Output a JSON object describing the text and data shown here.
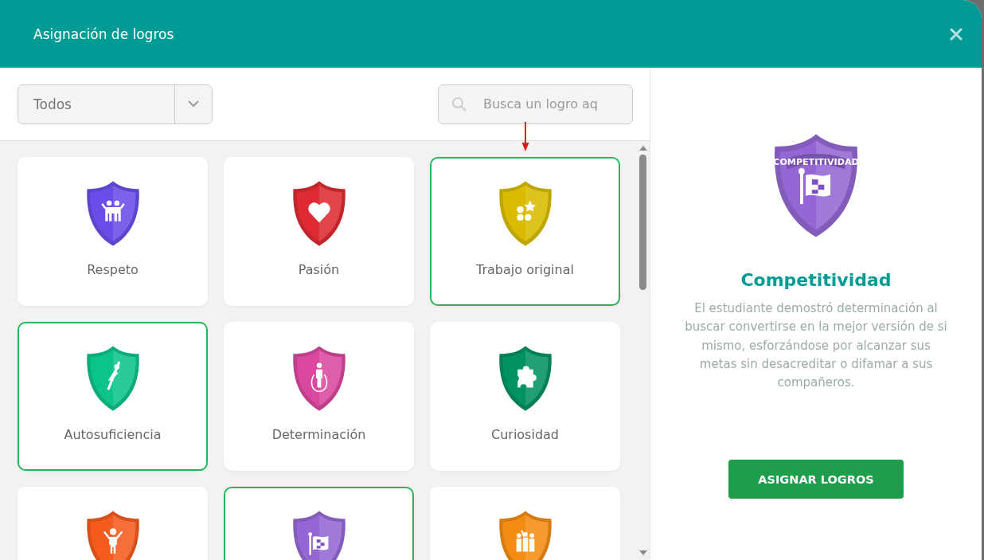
{
  "window": {
    "title": "Asignación de logros"
  },
  "filter": {
    "value": "Todos"
  },
  "search": {
    "placeholder": "Busca un logro aq"
  },
  "annotation_arrow": true,
  "achievements": [
    {
      "name": "Respeto",
      "color": "#6a4de8",
      "kind": "people",
      "selected": false
    },
    {
      "name": "Pasión",
      "color": "#de2a32",
      "kind": "heart",
      "selected": false
    },
    {
      "name": "Trabajo original",
      "color": "#d9bb00",
      "kind": "star-dots",
      "selected": true
    },
    {
      "name": "Autosuficiencia",
      "color": "#0cc48a",
      "kind": "flyer",
      "selected": true
    },
    {
      "name": "Determinación",
      "color": "#d9489e",
      "kind": "jump-rope",
      "selected": false
    },
    {
      "name": "Curiosidad",
      "color": "#00925f",
      "kind": "puzzle",
      "selected": false
    },
    {
      "color": "#f55a1e",
      "kind": "person",
      "selected": false
    },
    {
      "color": "#9467d4",
      "kind": "flag",
      "selected": true
    },
    {
      "color": "#f28c12",
      "kind": "group",
      "selected": false
    }
  ],
  "detail": {
    "color": "#9467d4",
    "kind": "flag",
    "badge_label": "COMPETITIVIDAD",
    "title": "Competitividad",
    "description": "El estudiante demostró determinación al buscar convertirse en la mejor versión de si mismo, esforzándose por alcanzar sus metas sin desacreditar o difamar a sus compañeros."
  },
  "assign_button": "ASIGNAR LOGROS"
}
